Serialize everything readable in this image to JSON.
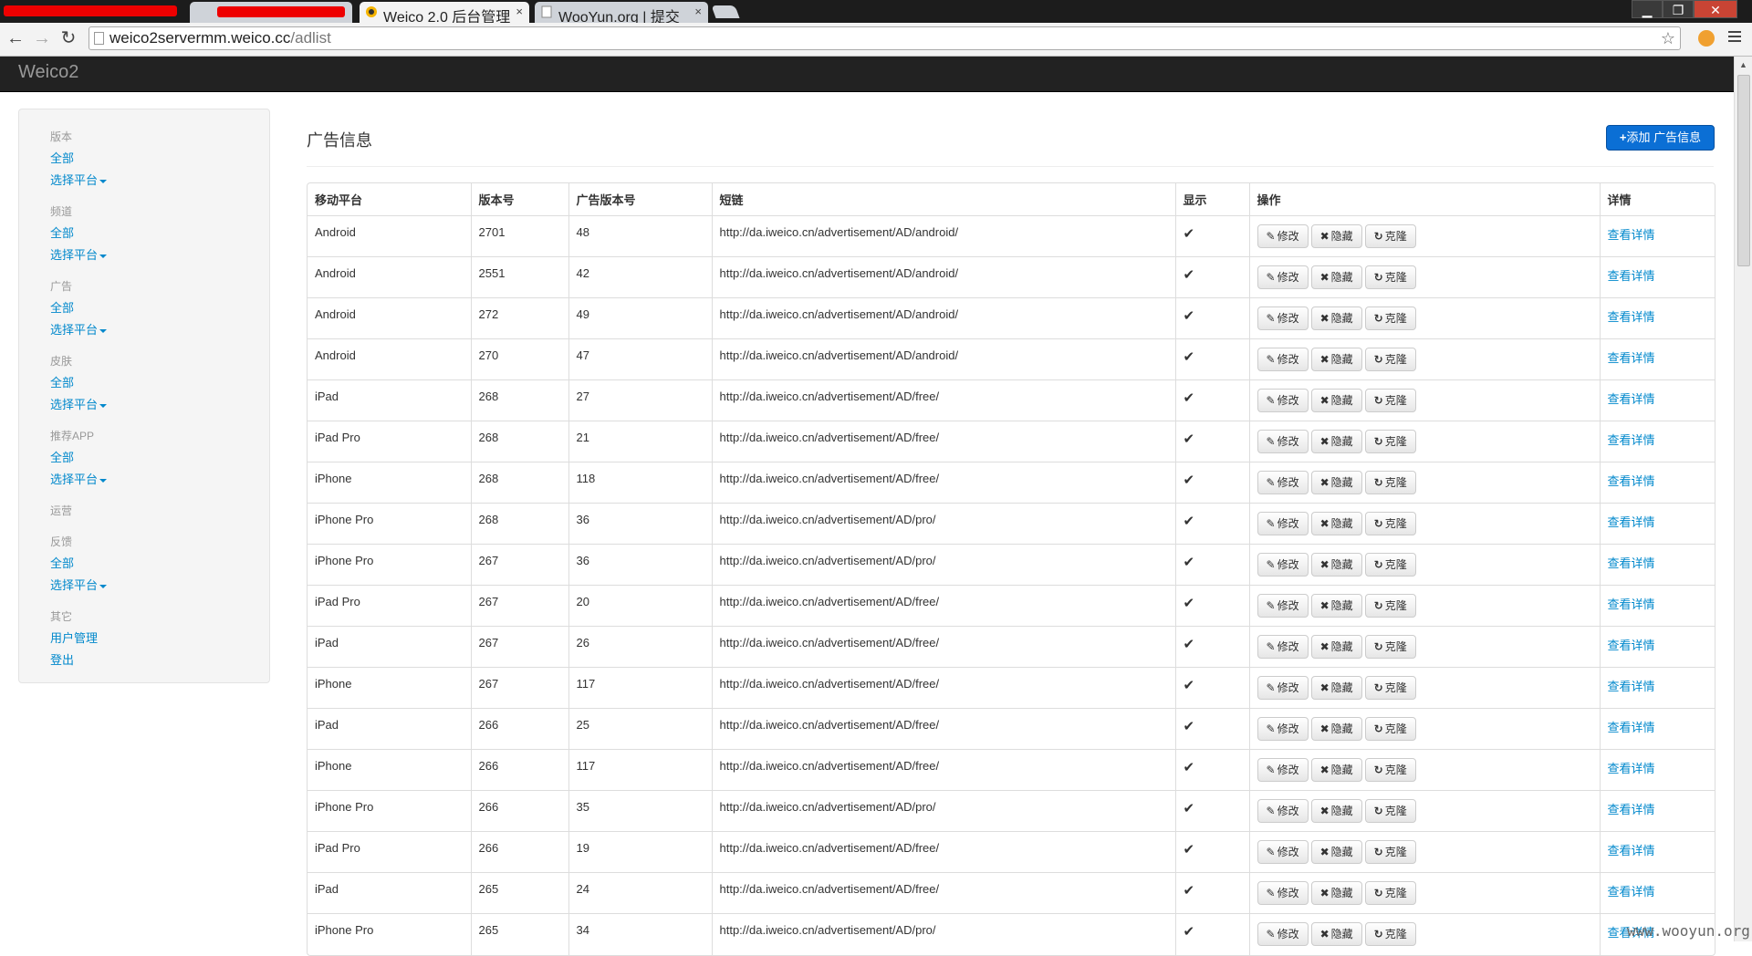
{
  "browser": {
    "tabs": [
      {
        "label": "",
        "redacted": true
      },
      {
        "label": "",
        "redacted": true
      },
      {
        "label": "Weico 2.0 后台管理",
        "active": true
      },
      {
        "label": "WooYun.org | 提交"
      }
    ],
    "close_glyph": "×",
    "url_host": "weico2servermm.weico.cc",
    "url_path": "/adlist"
  },
  "app": {
    "brand": "Weico2"
  },
  "sidebar": {
    "groups": [
      {
        "header": "版本",
        "links": [
          "全部",
          "选择平台"
        ]
      },
      {
        "header": "频道",
        "links": [
          "全部",
          "选择平台"
        ]
      },
      {
        "header": "广告",
        "links": [
          "全部",
          "选择平台"
        ]
      },
      {
        "header": "皮肤",
        "links": [
          "全部",
          "选择平台"
        ]
      },
      {
        "header": "推荐APP",
        "links": [
          "全部",
          "选择平台"
        ]
      },
      {
        "header": "运营",
        "links": []
      },
      {
        "header": "反馈",
        "links": [
          "全部",
          "选择平台"
        ]
      },
      {
        "header": "其它",
        "links": [
          "用户管理",
          "登出"
        ]
      }
    ]
  },
  "main": {
    "title": "广告信息",
    "add_button": "添加 广告信息",
    "columns": [
      "移动平台",
      "版本号",
      "广告版本号",
      "短链",
      "显示",
      "操作",
      "详情"
    ],
    "actions": {
      "edit": "修改",
      "hide": "隐藏",
      "clone": "克隆"
    },
    "detail_label": "查看详情",
    "check_glyph": "✔",
    "rows": [
      {
        "platform": "Android",
        "version": "2701",
        "ad_version": "48",
        "link": "http://da.iweico.cn/advertisement/AD/android/"
      },
      {
        "platform": "Android",
        "version": "2551",
        "ad_version": "42",
        "link": "http://da.iweico.cn/advertisement/AD/android/"
      },
      {
        "platform": "Android",
        "version": "272",
        "ad_version": "49",
        "link": "http://da.iweico.cn/advertisement/AD/android/"
      },
      {
        "platform": "Android",
        "version": "270",
        "ad_version": "47",
        "link": "http://da.iweico.cn/advertisement/AD/android/"
      },
      {
        "platform": "iPad",
        "version": "268",
        "ad_version": "27",
        "link": "http://da.iweico.cn/advertisement/AD/free/"
      },
      {
        "platform": "iPad Pro",
        "version": "268",
        "ad_version": "21",
        "link": "http://da.iweico.cn/advertisement/AD/free/"
      },
      {
        "platform": "iPhone",
        "version": "268",
        "ad_version": "118",
        "link": "http://da.iweico.cn/advertisement/AD/free/"
      },
      {
        "platform": "iPhone Pro",
        "version": "268",
        "ad_version": "36",
        "link": "http://da.iweico.cn/advertisement/AD/pro/"
      },
      {
        "platform": "iPhone Pro",
        "version": "267",
        "ad_version": "36",
        "link": "http://da.iweico.cn/advertisement/AD/pro/"
      },
      {
        "platform": "iPad Pro",
        "version": "267",
        "ad_version": "20",
        "link": "http://da.iweico.cn/advertisement/AD/free/"
      },
      {
        "platform": "iPad",
        "version": "267",
        "ad_version": "26",
        "link": "http://da.iweico.cn/advertisement/AD/free/"
      },
      {
        "platform": "iPhone",
        "version": "267",
        "ad_version": "117",
        "link": "http://da.iweico.cn/advertisement/AD/free/"
      },
      {
        "platform": "iPad",
        "version": "266",
        "ad_version": "25",
        "link": "http://da.iweico.cn/advertisement/AD/free/"
      },
      {
        "platform": "iPhone",
        "version": "266",
        "ad_version": "117",
        "link": "http://da.iweico.cn/advertisement/AD/free/"
      },
      {
        "platform": "iPhone Pro",
        "version": "266",
        "ad_version": "35",
        "link": "http://da.iweico.cn/advertisement/AD/pro/"
      },
      {
        "platform": "iPad Pro",
        "version": "266",
        "ad_version": "19",
        "link": "http://da.iweico.cn/advertisement/AD/free/"
      },
      {
        "platform": "iPad",
        "version": "265",
        "ad_version": "24",
        "link": "http://da.iweico.cn/advertisement/AD/free/"
      },
      {
        "platform": "iPhone Pro",
        "version": "265",
        "ad_version": "34",
        "link": "http://da.iweico.cn/advertisement/AD/pro/"
      }
    ]
  },
  "watermark": "www.wooyun.org",
  "colors": {
    "link": "#0088cc",
    "primary_button": "#0b6fd5",
    "navbar": "#222222"
  }
}
